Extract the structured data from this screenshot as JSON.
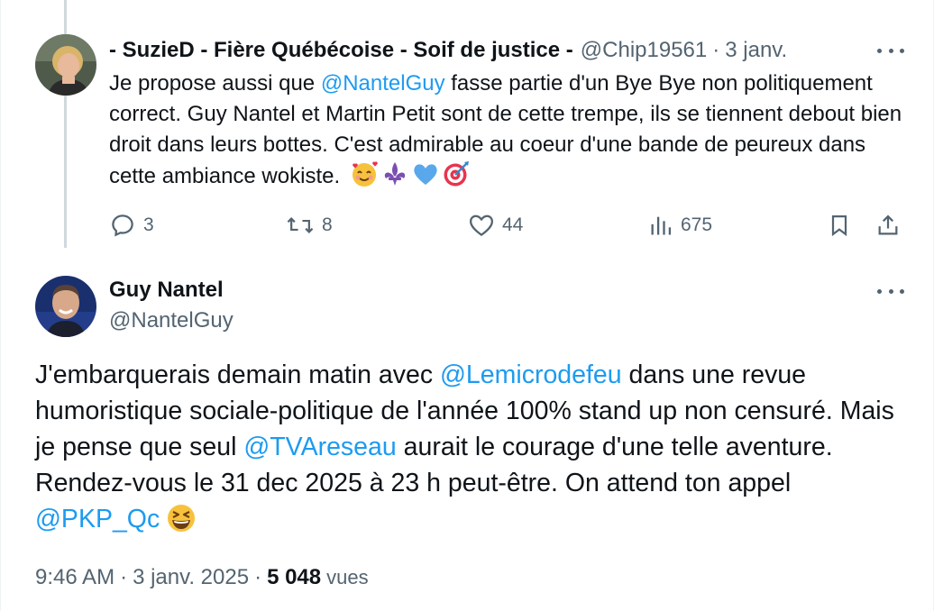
{
  "reply": {
    "display_name": "- SuzieD - Fière Québécoise - Soif de justice -",
    "handle": "@Chip19561",
    "separator": "·",
    "date": "3 janv.",
    "text": {
      "part1": "Je propose aussi que ",
      "mention1": "@NantelGuy",
      "part2": " fasse partie d'un Bye Bye non politiquement correct. Guy Nantel  et Martin Petit sont de cette trempe, ils se tiennent debout bien droit dans leurs bottes. C'est admirable au coeur d'une bande de peureux dans cette ambiance wokiste."
    },
    "emojis": [
      "smiling-face-with-hearts",
      "fleur-de-lis",
      "blue-heart",
      "direct-hit"
    ],
    "stats": {
      "replies": "3",
      "reposts": "8",
      "likes": "44",
      "views": "675"
    }
  },
  "main_post": {
    "display_name": "Guy Nantel",
    "handle": "@NantelGuy",
    "text": {
      "part1": "J'embarquerais demain matin avec ",
      "mention1": "@Lemicrodefeu",
      "part2": " dans une revue humoristique sociale-politique de l'année 100% stand up non censuré. Mais je pense que seul ",
      "mention2": "@TVAreseau",
      "part3": " aurait le courage d'une telle aventure. Rendez-vous le 31 dec 2025 à 23 h peut-être. On attend ton appel ",
      "mention3": "@PKP_Qc"
    },
    "emoji": "grinning-squinting-face",
    "time": "9:46 AM",
    "separator": "·",
    "date": "3 janv. 2025",
    "views_count": "5 048",
    "views_label": "vues"
  },
  "colors": {
    "text": "#0f1419",
    "muted": "#536471",
    "link": "#1d9bf0",
    "thread_line": "#cfd9de"
  }
}
